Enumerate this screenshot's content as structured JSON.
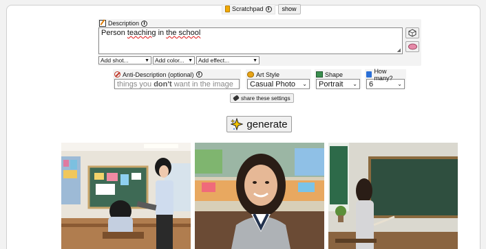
{
  "scratchpad": {
    "label": "Scratchpad",
    "show_label": "show"
  },
  "description": {
    "label": "Description",
    "text_parts": [
      "Person ",
      "teaching",
      " in ",
      "the school"
    ],
    "dropdowns": {
      "shot": "Add shot...",
      "color": "Add color...",
      "effect": "Add effect..."
    }
  },
  "anti_description": {
    "label": "Anti-Description (optional)",
    "placeholder_before": "things you ",
    "placeholder_bold": "don't",
    "placeholder_after": " want in the image"
  },
  "art_style": {
    "label": "Art Style",
    "value": "Casual Photo"
  },
  "shape": {
    "label": "Shape",
    "value": "Portrait"
  },
  "how_many": {
    "label": "How many?",
    "value": "6"
  },
  "share_label": "share these settings",
  "generate_label": "generate",
  "images": [
    {
      "name": "classroom-teacher-with-student"
    },
    {
      "name": "smiling-girl-in-classroom"
    },
    {
      "name": "teacher-at-chalkboard"
    }
  ],
  "colors": {
    "chalkboard": "#2f4f3f",
    "accent_blue": "#2a6fd6"
  }
}
